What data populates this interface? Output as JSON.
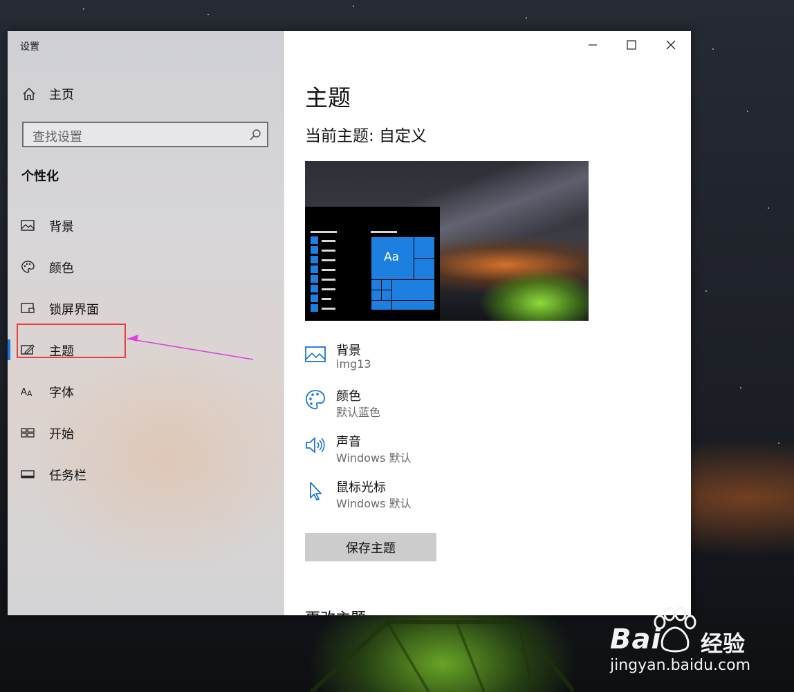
{
  "window": {
    "app_title": "设置",
    "controls": [
      "minimize",
      "maximize",
      "close"
    ]
  },
  "sidebar": {
    "home_label": "主页",
    "search_placeholder": "查找设置",
    "section_heading": "个性化",
    "items": [
      {
        "label": "背景",
        "icon": "picture-icon"
      },
      {
        "label": "颜色",
        "icon": "palette-icon"
      },
      {
        "label": "锁屏界面",
        "icon": "lock-screen-icon"
      },
      {
        "label": "主题",
        "icon": "theme-icon",
        "active": true
      },
      {
        "label": "字体",
        "icon": "font-icon"
      },
      {
        "label": "开始",
        "icon": "start-icon"
      },
      {
        "label": "任务栏",
        "icon": "taskbar-icon"
      }
    ]
  },
  "main": {
    "title": "主题",
    "current_theme": "当前主题: 自定义",
    "preview_tile_text": "Aa",
    "properties": [
      {
        "title": "背景",
        "value": "img13",
        "icon": "picture-icon"
      },
      {
        "title": "颜色",
        "value": "默认蓝色",
        "icon": "palette-icon"
      },
      {
        "title": "声音",
        "value": "Windows 默认",
        "icon": "speaker-icon"
      },
      {
        "title": "鼠标光标",
        "value": "Windows 默认",
        "icon": "cursor-icon"
      }
    ],
    "save_button": "保存主题",
    "change_theme_heading": "更改主题"
  },
  "watermark": {
    "brand": "Bai",
    "product": "经验",
    "url": "jingyan.baidu.com"
  },
  "colors": {
    "accent": "#1a73d8",
    "annotation": "#e8403c",
    "arrow": "#e040e0"
  }
}
